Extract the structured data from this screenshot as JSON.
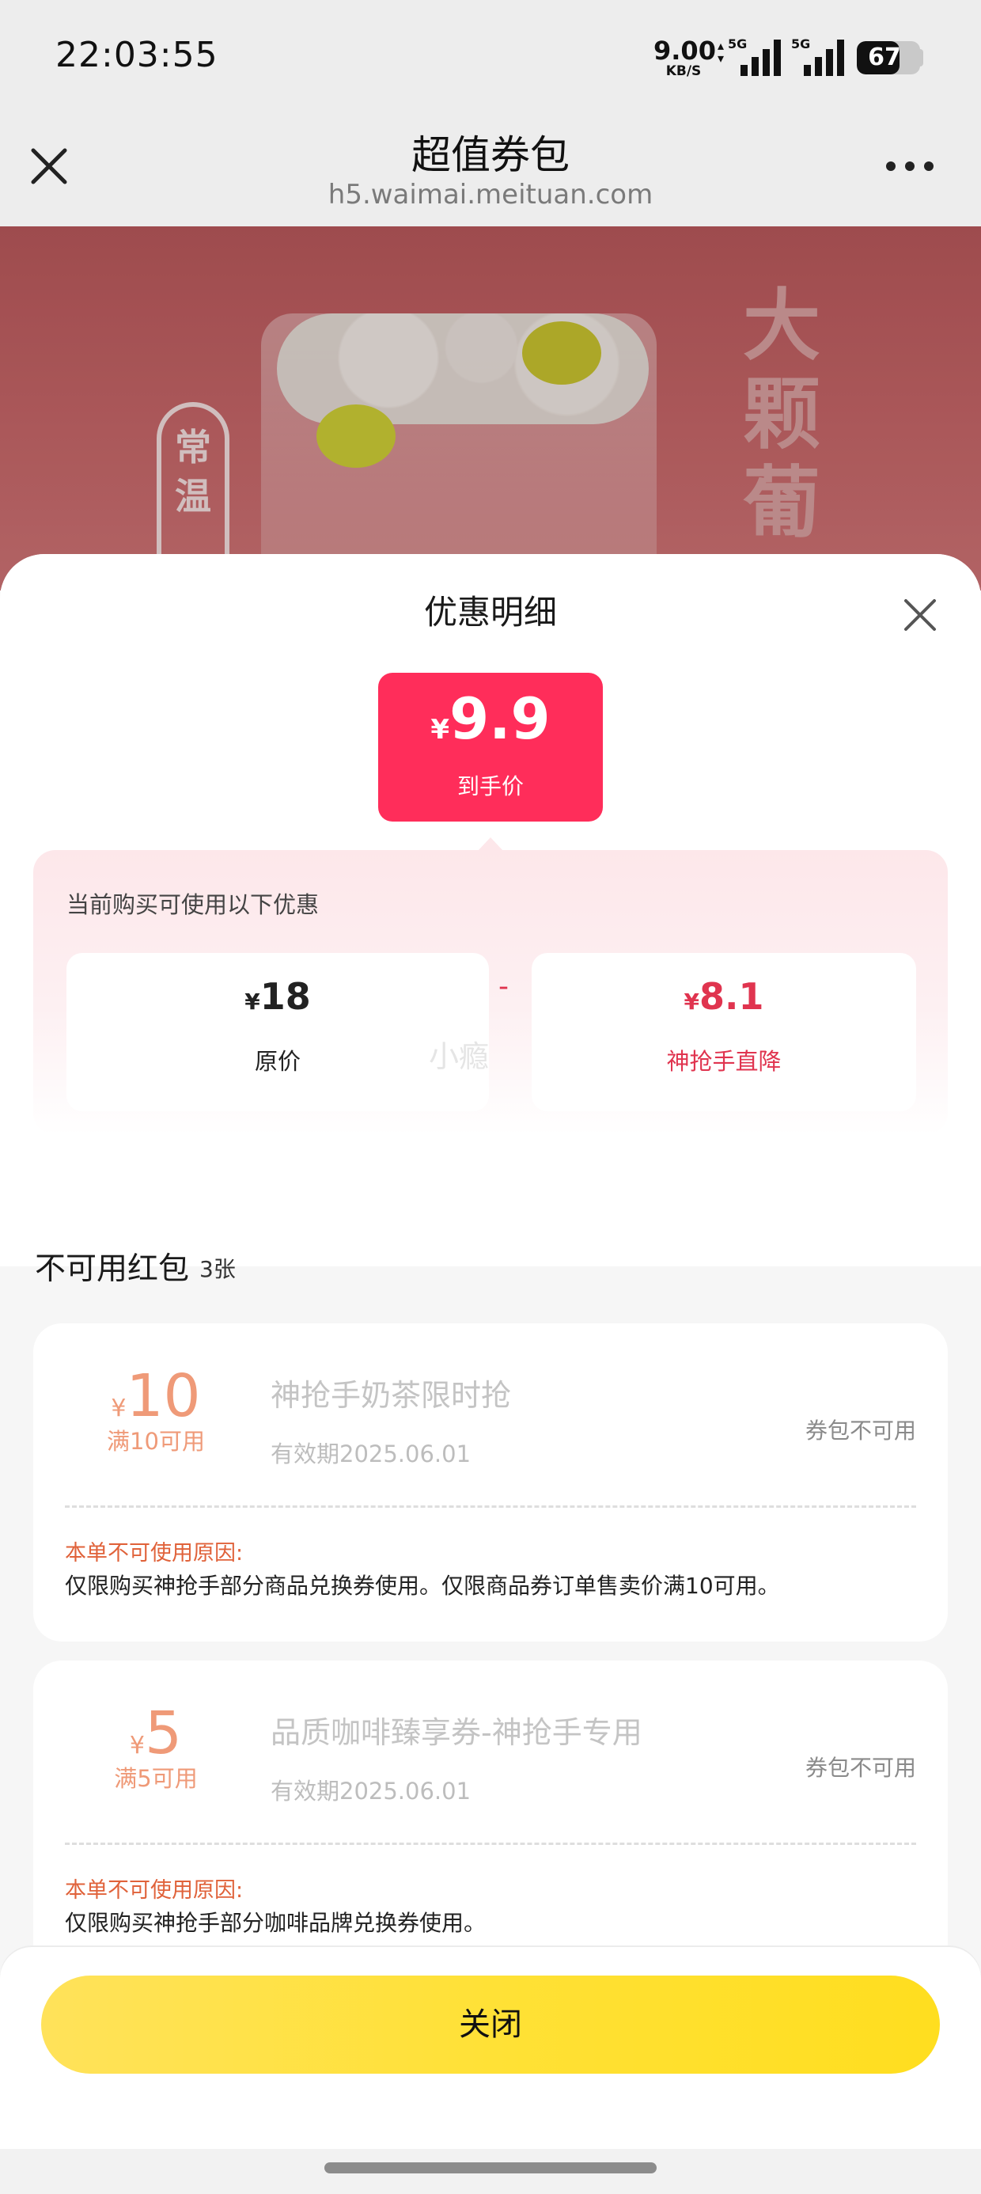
{
  "status_bar": {
    "time": "22:03:55",
    "net_rate": "9.00",
    "net_unit": "KB/S",
    "sim1_label": "5G",
    "sim2_label": "5G",
    "battery": "67",
    "battery_level": 0.67
  },
  "nav": {
    "title": "超值券包",
    "url": "h5.waimai.meituan.com",
    "close_icon": "close-icon",
    "more_icon": "more-icon"
  },
  "banner": {
    "tag": "常温",
    "big_text": "大颗葡"
  },
  "sheet": {
    "title": "优惠明细",
    "final_price": {
      "currency": "¥",
      "value": "9.9",
      "label": "到手价"
    },
    "hint": "当前购买可使用以下优惠",
    "original": {
      "currency": "¥",
      "value": "18",
      "label": "原价"
    },
    "operator": "-",
    "discount": {
      "currency": "¥",
      "value": "8.1",
      "label": "神抢手直降"
    },
    "watermark": "小瘾"
  },
  "unavailable": {
    "title": "不可用红包",
    "count": "3张",
    "coupons": [
      {
        "currency": "¥",
        "amount": "10",
        "condition": "满10可用",
        "name": "神抢手奶茶限时抢",
        "validity": "有效期2025.06.01",
        "status": "券包不可用",
        "reason_title": "本单不可使用原因:",
        "reason_text": "仅限购买神抢手部分商品兑换券使用。仅限商品券订单售卖价满10可用。"
      },
      {
        "currency": "¥",
        "amount": "5",
        "condition": "满5可用",
        "name": "品质咖啡臻享券-神抢手专用",
        "validity": "有效期2025.06.01",
        "status": "券包不可用",
        "reason_title": "本单不可使用原因:",
        "reason_text": "仅限购买神抢手部分咖啡品牌兑换券使用。"
      }
    ]
  },
  "footer": {
    "close_label": "关闭"
  },
  "colors": {
    "accent_red": "#ff2d5a",
    "discount_red": "#e0344f",
    "button_yellow": "#ffe136",
    "coupon_amount": "#ef9a78",
    "reason_orange": "#e0623a"
  }
}
